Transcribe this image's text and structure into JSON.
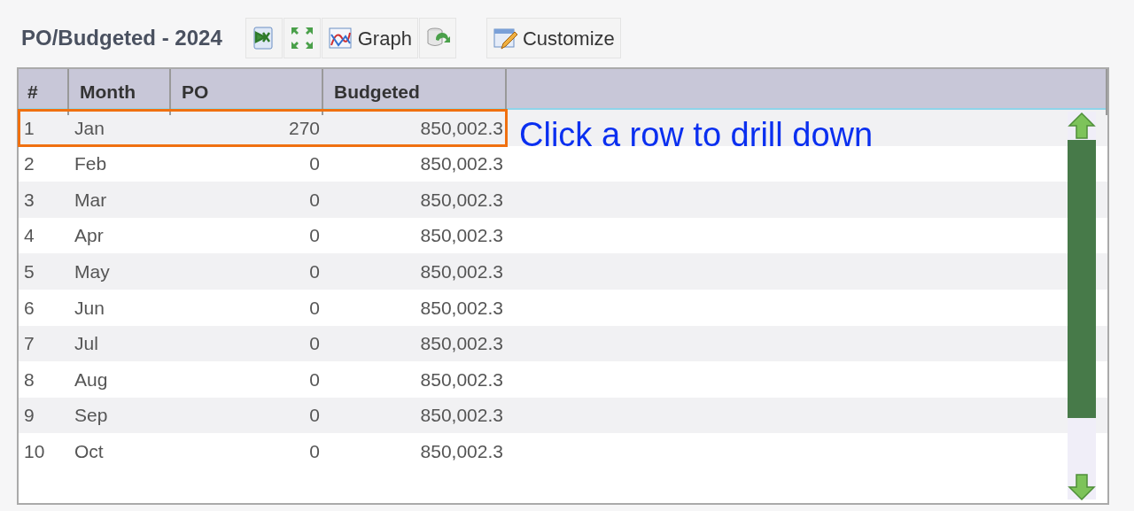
{
  "title": "PO/Budgeted - 2024",
  "toolbar": [
    {
      "kind": "excel"
    },
    {
      "kind": "expand"
    },
    {
      "kind": "graph",
      "label": "Graph"
    },
    {
      "kind": "refresh"
    },
    {
      "kind": "customize",
      "label": "Customize"
    }
  ],
  "table": {
    "columns": [
      "#",
      "Month",
      "PO",
      "Budgeted"
    ],
    "rows": [
      {
        "cells": [
          "1",
          "Jan",
          "270",
          "850,002.3"
        ],
        "outlined": true
      },
      {
        "cells": [
          "2",
          "Feb",
          "0",
          "850,002.3"
        ],
        "outlined": false
      },
      {
        "cells": [
          "3",
          "Mar",
          "0",
          "850,002.3"
        ],
        "outlined": false
      },
      {
        "cells": [
          "4",
          "Apr",
          "0",
          "850,002.3"
        ],
        "outlined": false
      },
      {
        "cells": [
          "5",
          "May",
          "0",
          "850,002.3"
        ],
        "outlined": false
      },
      {
        "cells": [
          "6",
          "Jun",
          "0",
          "850,002.3"
        ],
        "outlined": false
      },
      {
        "cells": [
          "7",
          "Jul",
          "0",
          "850,002.3"
        ],
        "outlined": false
      },
      {
        "cells": [
          "8",
          "Aug",
          "0",
          "850,002.3"
        ],
        "outlined": false
      },
      {
        "cells": [
          "9",
          "Sep",
          "0",
          "850,002.3"
        ],
        "outlined": false
      },
      {
        "cells": [
          "10",
          "Oct",
          "0",
          "850,002.3"
        ],
        "outlined": false
      }
    ]
  },
  "annotation": {
    "text": "Click a row to drill down"
  }
}
